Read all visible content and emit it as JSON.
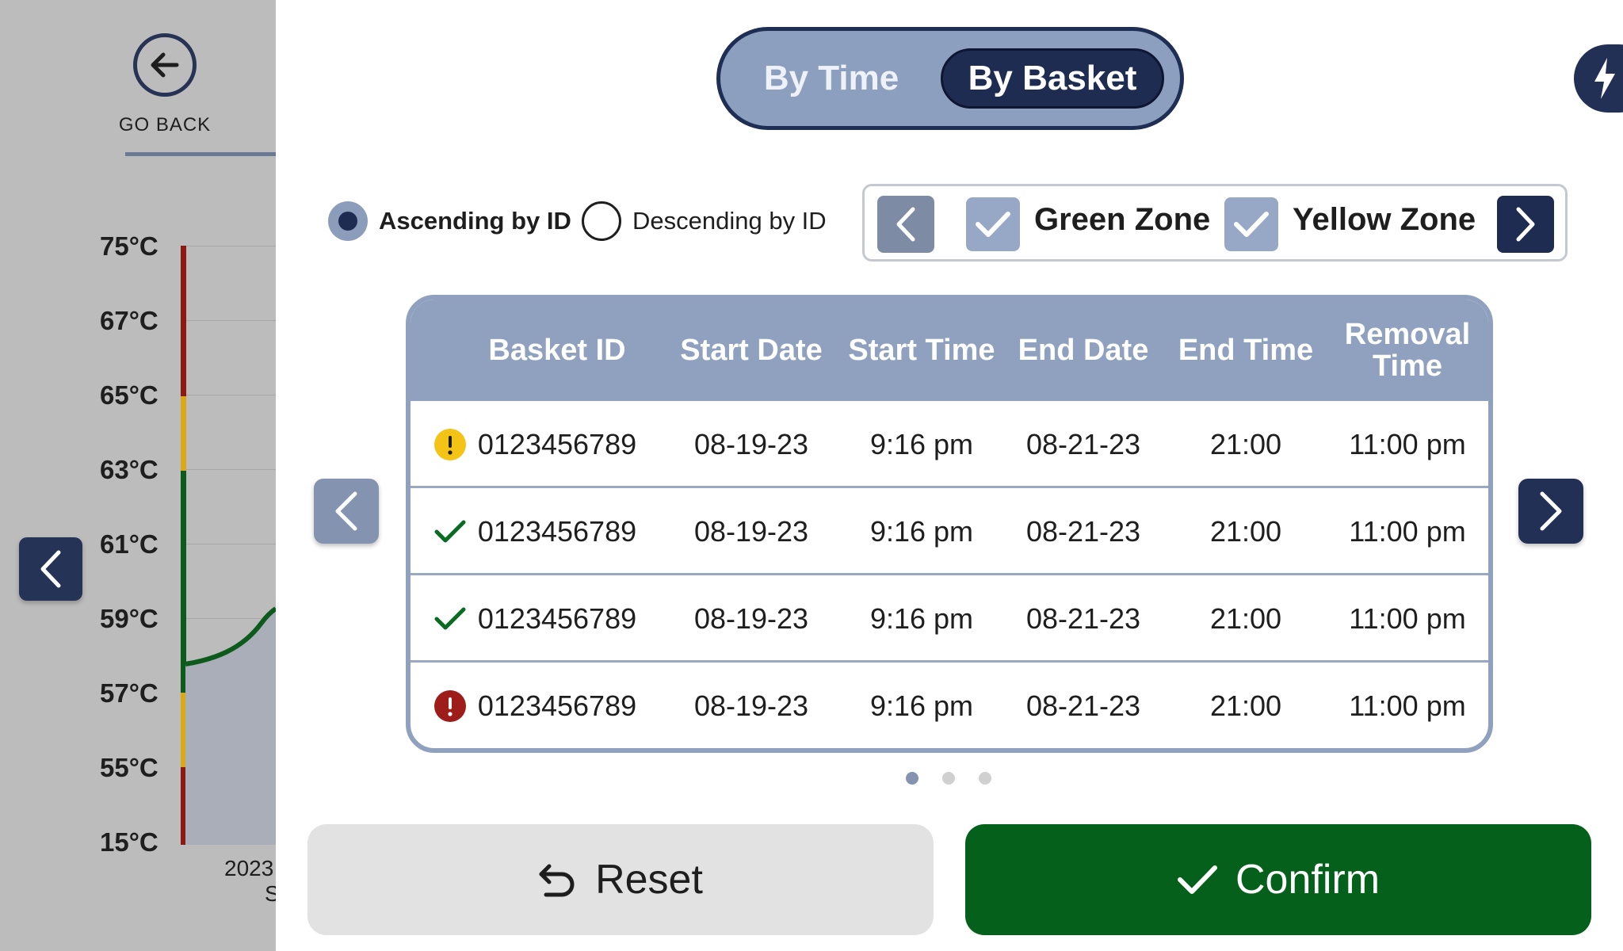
{
  "colors": {
    "navy": "#1f2c52",
    "slate": "#8fa1be",
    "confirm_green": "#05601b",
    "warning_yellow": "#f3c416",
    "error_red": "#9e1c1a",
    "ok_green": "#0a6b23",
    "chart_red": "#8b1a12",
    "chart_yellow": "#dba918",
    "chart_green": "#0d5a1d"
  },
  "background_panel": {
    "go_back_label": "GO BACK",
    "y_labels": [
      "75°C",
      "67°C",
      "65°C",
      "63°C",
      "61°C",
      "59°C",
      "57°C",
      "55°C",
      "15°C"
    ],
    "x_label_year": "2023",
    "x_label_partial": "S"
  },
  "view_toggle": {
    "options": [
      "By Time",
      "By Basket"
    ],
    "selected": "By Basket"
  },
  "sort": {
    "options": [
      "Ascending by ID",
      "Descending by ID"
    ],
    "selected": "Ascending by ID"
  },
  "zone_filter": {
    "zones": [
      {
        "label": "Green Zone",
        "checked": true
      },
      {
        "label": "Yellow Zone",
        "checked": true
      }
    ]
  },
  "table": {
    "headers": [
      "Basket ID",
      "Start Date",
      "Start Time",
      "End Date",
      "End Time",
      "Removal Time"
    ],
    "rows": [
      {
        "status": "warning-icon",
        "basket_id": "0123456789",
        "start_date": "08-19-23",
        "start_time": "9:16 pm",
        "end_date": "08-21-23",
        "end_time": "21:00",
        "removal_time": "11:00 pm"
      },
      {
        "status": "check-icon",
        "basket_id": "0123456789",
        "start_date": "08-19-23",
        "start_time": "9:16 pm",
        "end_date": "08-21-23",
        "end_time": "21:00",
        "removal_time": "11:00 pm"
      },
      {
        "status": "check-icon",
        "basket_id": "0123456789",
        "start_date": "08-19-23",
        "start_time": "9:16 pm",
        "end_date": "08-21-23",
        "end_time": "21:00",
        "removal_time": "11:00 pm"
      },
      {
        "status": "error-icon",
        "basket_id": "0123456789",
        "start_date": "08-19-23",
        "start_time": "9:16 pm",
        "end_date": "08-21-23",
        "end_time": "21:00",
        "removal_time": "11:00 pm"
      }
    ]
  },
  "pagination": {
    "pages": 3,
    "current": 1
  },
  "actions": {
    "reset_label": "Reset",
    "confirm_label": "Confirm"
  }
}
